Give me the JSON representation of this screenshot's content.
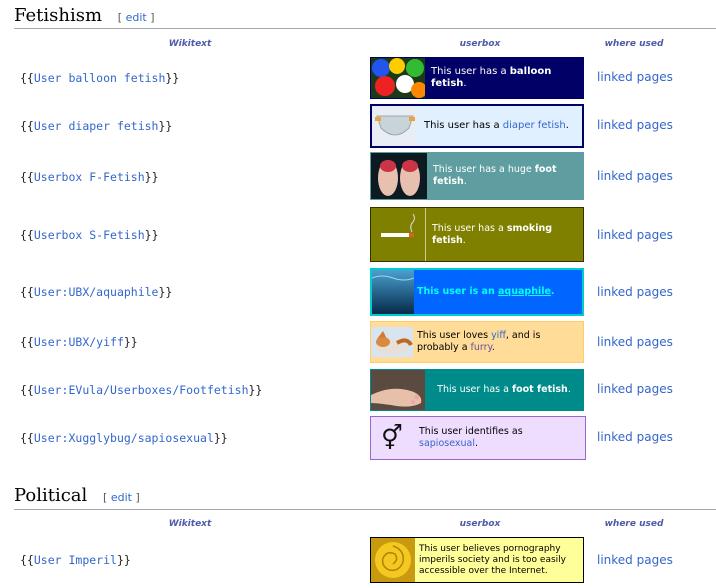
{
  "sections": [
    {
      "title": "Fetishism",
      "edit_open": "[",
      "edit_label": "edit",
      "edit_close": "]",
      "col_wikitext": "Wikitext",
      "col_userbox": "userbox",
      "col_used": "where used"
    },
    {
      "title": "Political",
      "edit_open": "[",
      "edit_label": "edit",
      "edit_close": "]",
      "col_wikitext": "Wikitext",
      "col_userbox": "userbox",
      "col_used": "where used"
    }
  ],
  "rows": [
    {
      "open": "{{",
      "name": "User balloon fetish",
      "close": "}}",
      "used": "linked pages",
      "t1": "This user has a ",
      "b1": "balloon fetish",
      "t2": ".",
      "l1": "",
      "t3": "",
      "l2": "",
      "t4": "",
      "bg": "#000066",
      "border": "#000066",
      "color": "#ffffff",
      "icon": "balloons-icon"
    },
    {
      "open": "{{",
      "name": "User diaper fetish",
      "close": "}}",
      "used": "linked pages",
      "t1": "This user has a ",
      "b1": "",
      "t2": "",
      "l1": "diaper fetish",
      "t3": ".",
      "l2": "",
      "t4": "",
      "bg": "#e0f0ff",
      "border": "#000066",
      "color": "#000000",
      "icon": "diaper-icon"
    },
    {
      "open": "{{",
      "name": "Userbox F-Fetish",
      "close": "}}",
      "used": "linked pages",
      "t1": "This user has a huge ",
      "b1": "foot fetish",
      "t2": ".",
      "l1": "",
      "t3": "",
      "l2": "",
      "t4": "",
      "bg": "#5f9ea0",
      "border": "#5f9ea0",
      "color": "#ffffff",
      "icon": "feet-icon"
    },
    {
      "open": "{{",
      "name": "Userbox S-Fetish",
      "close": "}}",
      "used": "linked pages",
      "t1": "This user has a ",
      "b1": "smoking fetish",
      "t2": ".",
      "l1": "",
      "t3": "",
      "l2": "",
      "t4": "",
      "bg": "#808000",
      "border": "#333300",
      "color": "#ffffff",
      "icon": "cigarette-icon"
    },
    {
      "open": "{{",
      "name": "User:UBX/aquaphile",
      "close": "}}",
      "used": "linked pages",
      "t1": "",
      "b1": "This user is an ",
      "t2": "",
      "l1": "aquaphile",
      "t3": ".",
      "l2": "",
      "t4": "",
      "bg": "#0066ff",
      "border": "#00cccc",
      "color": "#00ffff",
      "icon": "water-icon"
    },
    {
      "open": "{{",
      "name": "User:UBX/yiff",
      "close": "}}",
      "used": "linked pages",
      "t1": "This user loves ",
      "b1": "",
      "t2": "",
      "l1": "yiff",
      "t3": ", and is probably a ",
      "l2": "furry",
      "t4": ".",
      "bg": "#ffdd99",
      "border": "#ffcc66",
      "color": "#000000",
      "icon": "fox-icon"
    },
    {
      "open": "{{",
      "name": "User:EVula/Userboxes/Footfetish",
      "close": "}}",
      "used": "linked pages",
      "t1": "This user has a ",
      "b1": "foot fetish",
      "t2": ".",
      "l1": "",
      "t3": "",
      "l2": "",
      "t4": "",
      "bg": "#008b8b",
      "border": "#008b8b",
      "color": "#ffffff",
      "icon": "foot-icon"
    },
    {
      "open": "{{",
      "name": "User:Xugglybug/sapiosexual",
      "close": "}}",
      "used": "linked pages",
      "t1": "This user identifies as ",
      "b1": "",
      "t2": "",
      "l1": "sapiosexual",
      "t3": ".",
      "l2": "",
      "t4": "",
      "bg": "#eeddff",
      "border": "#9966cc",
      "color": "#000000",
      "icon": "gender-symbol-icon",
      "glyph": "⚥"
    },
    {
      "open": "{{",
      "name": "User Imperil",
      "close": "}}",
      "used": "linked pages",
      "t1": "This user believes pornography imperils society and is too easily accessible over the Internet.",
      "b1": "",
      "t2": "",
      "l1": "",
      "t3": "",
      "l2": "",
      "t4": "",
      "bg": "#ffff99",
      "border": "#000000",
      "color": "#000000",
      "icon": "rose-icon"
    }
  ]
}
